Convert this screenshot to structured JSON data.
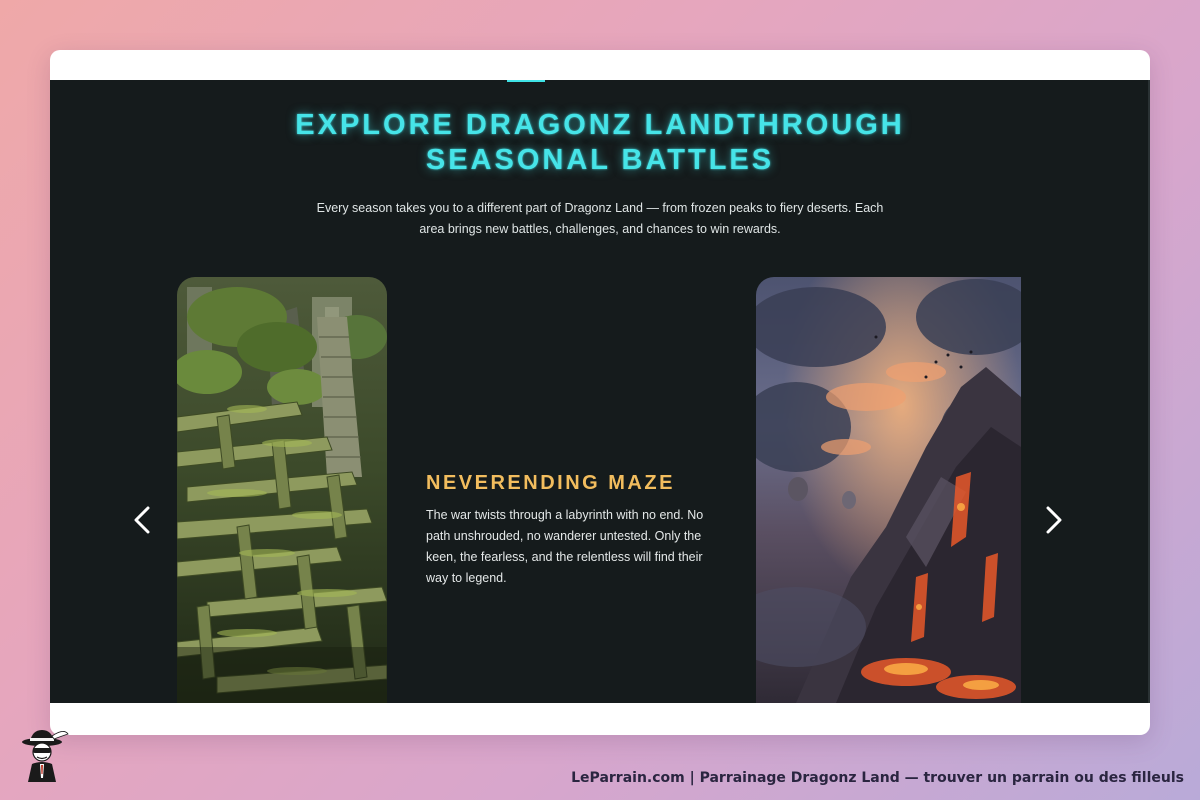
{
  "section": {
    "headline_line1": "EXPLORE DRAGONZ LANDTHROUGH",
    "headline_line2": "SEASONAL BATTLES",
    "subtitle": "Every season takes you to a different part of Dragonz Land — from frozen peaks to fiery deserts. Each area brings new battles, challenges, and chances to win rewards."
  },
  "carousel": {
    "active_slide": {
      "title": "NEVERENDING MAZE",
      "description": "The war twists through a labyrinth with no end. No path unshrouded, no wanderer untested. Only the keen, the fearless, and the relentless will find their way to legend.",
      "image_icon": "overgrown-maze-image"
    },
    "next_slide": {
      "image_icon": "volcanic-mountain-image"
    },
    "prev_icon": "chevron-left-icon",
    "next_icon": "chevron-right-icon"
  },
  "footer": {
    "caption": "LeParrain.com | Parrainage Dragonz Land — trouver un parrain ou des filleuls",
    "logo_icon": "leparrain-mascot-logo"
  },
  "colors": {
    "page_gradient": [
      "#efa8a8",
      "#d8a6cc",
      "#b9aad8"
    ],
    "section_bg": "#151b1c",
    "headline": "#46e4e8",
    "slide_title": "#f2bd5e",
    "body_text": "#dfe5e5"
  }
}
